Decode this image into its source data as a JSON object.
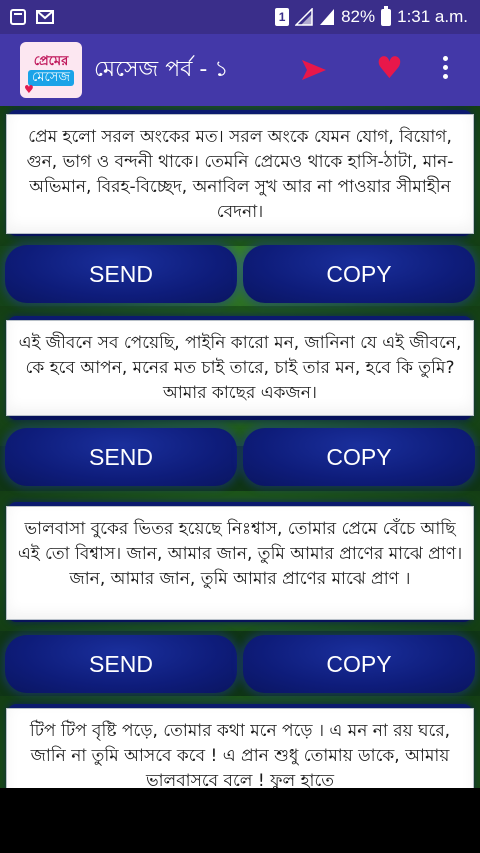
{
  "status_bar": {
    "sim": "1",
    "battery": "82%",
    "time": "1:31 a.m."
  },
  "app_bar": {
    "logo_line1": "প্রেমের",
    "logo_line2": "মেসেজ",
    "title": "মেসেজ পর্ব - ১",
    "icons": [
      "send-icon",
      "heart-icon",
      "more-vert-icon"
    ],
    "colors": {
      "bar": "#4338a8",
      "send": "#e8174a",
      "heart": "#e8174a"
    }
  },
  "messages": [
    {
      "text": "প্রেম হলো সরল অংকের মত। সরল অংকে যেমন যোগ, বিয়োগ, গুন, ভাগ ও বন্দনী থাকে। তেমনি প্রেমেও থাকে হাসি-ঠাটা, মান-অভিমান, বিরহ-বিচ্ছেদ, অনাবিল সুখ আর না পাওয়ার সীমাহীন বেদনা।"
    },
    {
      "text": "এই জীবনে সব পেয়েছি, পাইনি কারো মন, জানিনা যে এই জীবনে, কে হবে আপন, মনের মত চাই তারে, চাই তার মন, হবে কি তুমি? আমার কাছের একজন।"
    },
    {
      "text": "ভালবাসা বুকের ভিতর হয়েছে নিঃশ্বাস, তোমার প্রেমে বেঁচে আছি এই তো বিশ্বাস। জান, আমার জান, তুমি আমার প্রাণের মাঝে প্রাণ।  জান, আমার জান, তুমি আমার প্রাণের মাঝে প্রাণ ।"
    },
    {
      "text": "টিপ টিপ বৃষ্টি পড়ে, তোমার কথা মনে পড়ে । এ মন না রয় ঘরে, জানি না তুমি আসবে কবে ! এ প্রান শুধু তোমায় ডাকে, আমায় ভালবাসবে বলে ! ফুল হাতে"
    }
  ],
  "buttons": {
    "send": "SEND",
    "copy": "COPY"
  }
}
